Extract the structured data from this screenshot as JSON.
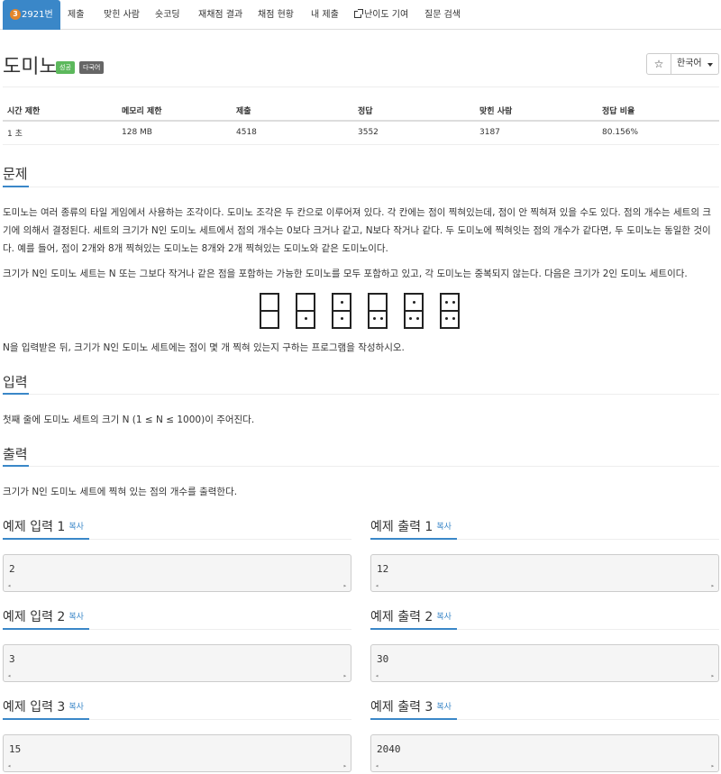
{
  "nav": {
    "tabs": [
      {
        "label": "2921번",
        "tier": "3"
      },
      {
        "label": "제출"
      },
      {
        "label": "맞힌 사람"
      },
      {
        "label": "숏코딩"
      },
      {
        "label": "재채점 결과"
      },
      {
        "label": "채점 현황"
      },
      {
        "label": "내 제출"
      },
      {
        "label": "난이도 기여"
      },
      {
        "label": "질문 검색"
      }
    ]
  },
  "problem": {
    "title": "도미노",
    "badges": [
      "성공",
      "다국어"
    ],
    "star": "☆",
    "language": "한국어"
  },
  "info": {
    "headers": [
      "시간 제한",
      "메모리 제한",
      "제출",
      "정답",
      "맞힌 사람",
      "정답 비율"
    ],
    "values": [
      "1 초",
      "128 MB",
      "4518",
      "3552",
      "3187",
      "80.156%"
    ]
  },
  "sections": {
    "problem_heading": "문제",
    "problem_p1": "도미노는 여러 종류의 타일 게임에서 사용하는 조각이다. 도미노 조각은 두 칸으로 이루어져 있다. 각 칸에는 점이 찍혀있는데, 점이 안 찍혀져 있을 수도 있다. 점의 개수는 세트의 크기에 의해서 결정된다. 세트의 크기가 N인 도미노 세트에서 점의 개수는 0보다 크거나 같고, N보다 작거나 같다. 두 도미노에 찍혀잇는 점의 개수가 같다면, 두 도미노는 동일한 것이다. 예를 들어, 점이 2개와 8개 찍혀있는 도미노는 8개와 2개 찍혀있는 도미노와 같은 도미노이다.",
    "problem_p2": "크기가 N인 도미노 세트는 N 또는 그보다 작거나 같은 점을 포함하는 가능한 도미노를 모두 포함하고 있고, 각 도미노는 중복되지 않는다. 다음은 크기가 2인 도미노 세트이다.",
    "problem_p3": "N을 입력받은 뒤, 크기가 N인 도미노 세트에는 점이 몇 개 찍혀 있는지 구하는 프로그램을 작성하시오.",
    "input_heading": "입력",
    "input_text": "첫째 줄에 도미노 세트의 크기 N (1 ≤ N ≤ 1000)이 주어진다.",
    "output_heading": "출력",
    "output_text": "크기가 N인 도미노 세트에 찍혀 있는 점의 개수를 출력한다."
  },
  "dominoes": [
    [
      0,
      0
    ],
    [
      0,
      1
    ],
    [
      1,
      1
    ],
    [
      0,
      2
    ],
    [
      1,
      2
    ],
    [
      2,
      2
    ]
  ],
  "examples": {
    "copy_label": "복사",
    "inputs": [
      {
        "title": "예제 입력 1",
        "value": "2"
      },
      {
        "title": "예제 입력 2",
        "value": "3"
      },
      {
        "title": "예제 입력 3",
        "value": "15"
      }
    ],
    "outputs": [
      {
        "title": "예제 출력 1",
        "value": "12"
      },
      {
        "title": "예제 출력 2",
        "value": "30"
      },
      {
        "title": "예제 출력 3",
        "value": "2040"
      }
    ]
  }
}
